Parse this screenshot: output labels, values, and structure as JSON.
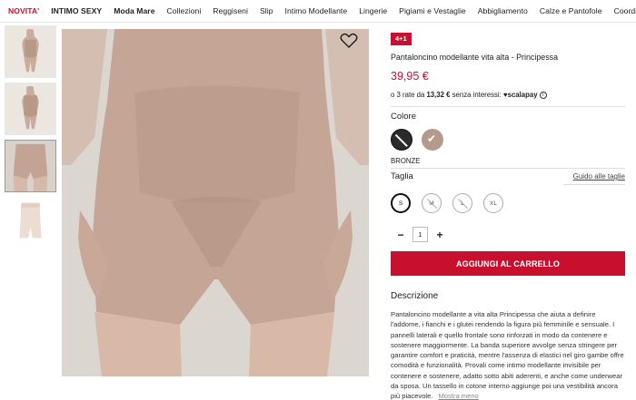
{
  "nav": {
    "items": [
      {
        "label": "NOVITA'",
        "style": "red"
      },
      {
        "label": "INTIMO SEXY",
        "style": "bold"
      },
      {
        "label": "Moda Mare",
        "style": "active"
      },
      {
        "label": "Collezioni",
        "style": ""
      },
      {
        "label": "Reggiseni",
        "style": ""
      },
      {
        "label": "Slip",
        "style": ""
      },
      {
        "label": "Intimo Modellante",
        "style": ""
      },
      {
        "label": "Lingerie",
        "style": ""
      },
      {
        "label": "Pigiami e Vestaglie",
        "style": ""
      },
      {
        "label": "Abbigliamento",
        "style": ""
      },
      {
        "label": "Calze e Pantofole",
        "style": ""
      },
      {
        "label": "Coordinati P",
        "style": ""
      }
    ]
  },
  "gallery": {
    "wishlist_icon": "heart-icon",
    "thumbnail_count": 4,
    "selected_thumbnail": 3
  },
  "product": {
    "badge": "4+1",
    "name": "Pantaloncino modellante vita alta - Principessa",
    "price": "39,95 €",
    "installments": {
      "prefix": "o 3 rate da",
      "amount": "13,32 €",
      "suffix": "senza interessi:",
      "provider": "scalapay",
      "info_icon": "info-icon"
    }
  },
  "color": {
    "title": "Colore",
    "options": [
      "black",
      "bronze"
    ],
    "selected_label": "BRONZE",
    "colors": {
      "black": "#2b2b2b",
      "bronze": "#b39a8b"
    }
  },
  "size": {
    "title": "Taglia",
    "guide_link": "Guido alle taglie",
    "options": [
      {
        "label": "S",
        "selected": true,
        "available": true
      },
      {
        "label": "M",
        "selected": false,
        "available": false
      },
      {
        "label": "L",
        "selected": false,
        "available": false
      },
      {
        "label": "XL",
        "selected": false,
        "available": true
      }
    ]
  },
  "quantity": {
    "minus": "−",
    "value": "1",
    "plus": "+"
  },
  "cart": {
    "add_label": "AGGIUNGI AL CARRELLO"
  },
  "description": {
    "title": "Descrizione",
    "text": "Pantaloncino modellante a vita alta Principessa che aiuta a definire l'addome, i fianchi e i glutei rendendo la figura più femminile e sensuale. I pannelli laterali e quello frontale sono rinforzati in modo da contenere e sostenere maggiormente. La banda superiore avvolge senza stringere per garantire comfort e praticità, mentre l'assenza di elastici nel giro gambe offre comodità e funzionalità. Provali come intimo modellante invisibile per contenere e sostenere, adatto sotto abiti aderenti, e anche come underwear da sposa. Un tassello in cotone interno aggiunge poi una vestibilità ancora più piacevole.",
    "more_link": "Mostra meno"
  },
  "accent": "#c8102e"
}
